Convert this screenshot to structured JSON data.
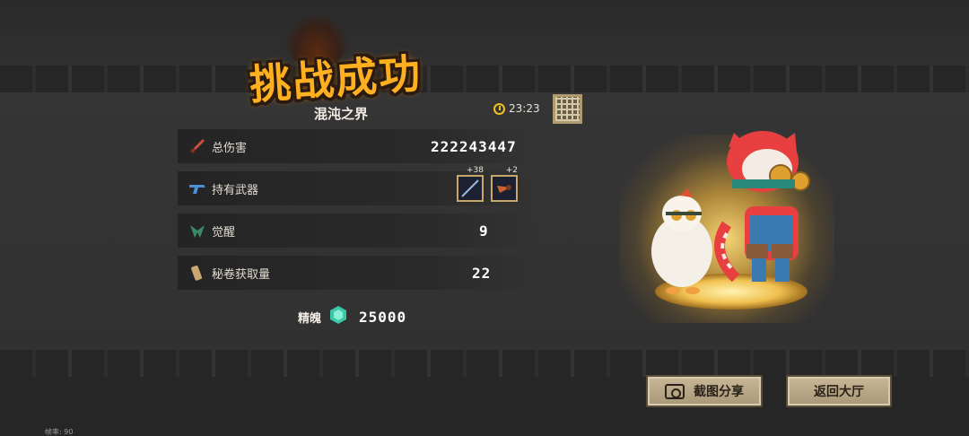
{
  "header": {
    "title": "挑战成功",
    "stage_name": "混沌之界",
    "timer": "23:23"
  },
  "stats": [
    {
      "label": "总伤害",
      "value": "222243447",
      "icon": "dagger-icon"
    },
    {
      "label": "持有武器",
      "value": "",
      "icon": "gun-icon"
    },
    {
      "label": "觉醒",
      "value": "9",
      "icon": "awaken-icon"
    },
    {
      "label": "秘卷获取量",
      "value": "22",
      "icon": "scroll-icon"
    }
  ],
  "weapons": [
    {
      "icon": "spear-icon",
      "level": "+38"
    },
    {
      "icon": "drill-icon",
      "level": "+2"
    }
  ],
  "essence": {
    "label": "精魄",
    "value": "25000",
    "icon": "gem-icon"
  },
  "buttons": {
    "share_label": "截图分享",
    "back_label": "返回大厅"
  },
  "footer": {
    "fps": "帧率: 90"
  },
  "colors": {
    "title": "#ffb020",
    "button_bg": "#c8b898",
    "glow": "#f0c050"
  }
}
